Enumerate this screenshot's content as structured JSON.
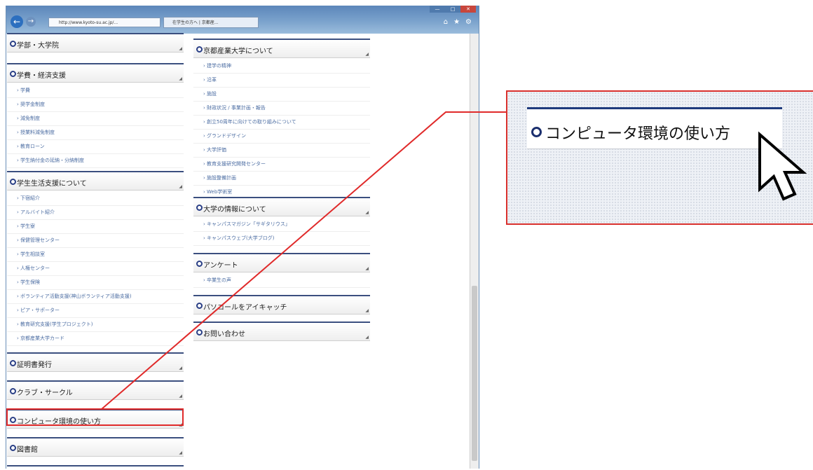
{
  "browser": {
    "address": "http://www.kyoto-su.ac.jp/... ",
    "tab_label": "在学生の方へ | 京都産...",
    "win_min": "—",
    "win_max": "□",
    "win_close": "✕"
  },
  "left_panels": [
    {
      "title": "学部・大学院",
      "items": []
    },
    {
      "title": "学費・経済支援",
      "items": [
        "学費",
        "奨学金制度",
        "減免制度",
        "授業料減免制度",
        "教育ローン",
        "学生納付金の延納・分納制度"
      ]
    },
    {
      "title": "学生生活支援について",
      "items": [
        "下宿紹介",
        "アルバイト紹介",
        "学生寮",
        "保健管理センター",
        "学生相談室",
        "人権センター",
        "学生保険",
        "ボランティア活動支援(神山ボランティア活動支援)",
        "ピア・サポーター",
        "教育研究支援(学生プロジェクト)",
        "京都産業大学カード"
      ]
    },
    {
      "title": "証明書発行",
      "items": []
    },
    {
      "title": "クラブ・サークル",
      "items": []
    },
    {
      "title": "コンピュータ環境の使い方",
      "items": []
    },
    {
      "title": "図書館",
      "items": []
    }
  ],
  "right_panels": [
    {
      "title": "京都産業大学について",
      "items": [
        "建学の精神",
        "沿革",
        "施設",
        "財政状況 / 事業計画・報告",
        "創立50周年に向けての取り組みについて",
        "グランドデザイン",
        "大学評価",
        "教育支援研究開発センター",
        "施設整備計画",
        "Web学術室"
      ]
    },
    {
      "title": "大学の情報について",
      "items": [
        "キャンパスマガジン「サギタリウス」",
        "キャンパスウェブ(大学ブログ)"
      ]
    },
    {
      "title": "アンケート",
      "items": [
        "卒業生の声"
      ]
    },
    {
      "title": "パソコールをアイキャッチ",
      "items": []
    },
    {
      "title": "お問い合わせ",
      "items": []
    }
  ],
  "callout": {
    "label": "コンピュータ環境の使い方"
  },
  "colors": {
    "highlight": "#e02a2a",
    "accent": "#1f3b7d",
    "link": "#4d6ea3"
  },
  "icons": [
    "back-arrow-icon",
    "forward-arrow-icon",
    "home-icon",
    "star-icon",
    "gear-icon",
    "pointer-cursor-icon"
  ]
}
